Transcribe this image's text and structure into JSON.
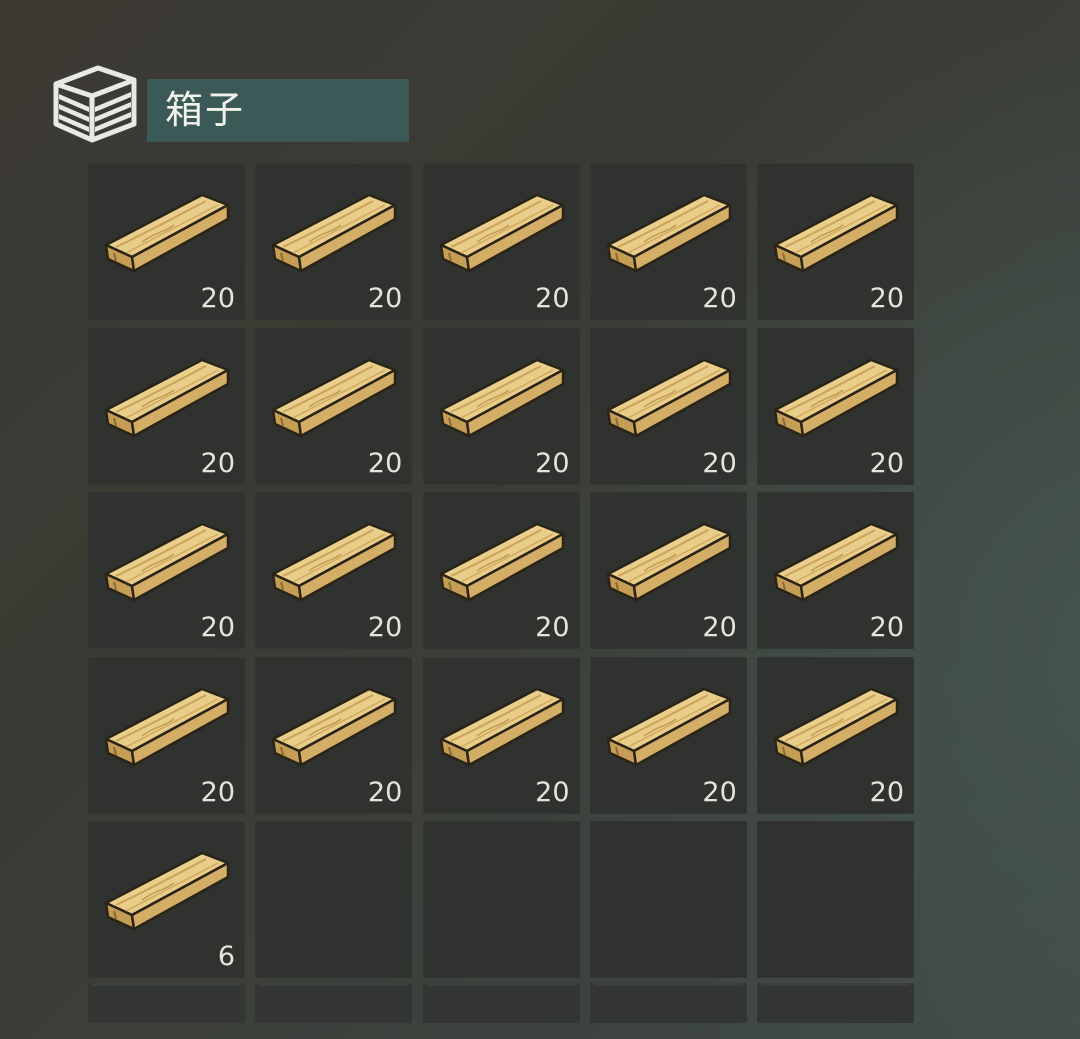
{
  "container": {
    "title": "箱子",
    "icon": "storage-box-icon"
  },
  "inventory": {
    "item_icon": "wooden-plank-icon",
    "slots": [
      {
        "item": "wooden-plank",
        "count": "20"
      },
      {
        "item": "wooden-plank",
        "count": "20"
      },
      {
        "item": "wooden-plank",
        "count": "20"
      },
      {
        "item": "wooden-plank",
        "count": "20"
      },
      {
        "item": "wooden-plank",
        "count": "20"
      },
      {
        "item": "wooden-plank",
        "count": "20"
      },
      {
        "item": "wooden-plank",
        "count": "20"
      },
      {
        "item": "wooden-plank",
        "count": "20"
      },
      {
        "item": "wooden-plank",
        "count": "20"
      },
      {
        "item": "wooden-plank",
        "count": "20"
      },
      {
        "item": "wooden-plank",
        "count": "20"
      },
      {
        "item": "wooden-plank",
        "count": "20"
      },
      {
        "item": "wooden-plank",
        "count": "20"
      },
      {
        "item": "wooden-plank",
        "count": "20"
      },
      {
        "item": "wooden-plank",
        "count": "20"
      },
      {
        "item": "wooden-plank",
        "count": "20"
      },
      {
        "item": "wooden-plank",
        "count": "20"
      },
      {
        "item": "wooden-plank",
        "count": "20"
      },
      {
        "item": "wooden-plank",
        "count": "20"
      },
      {
        "item": "wooden-plank",
        "count": "20"
      },
      {
        "item": "wooden-plank",
        "count": "6"
      },
      {
        "item": null,
        "count": null
      },
      {
        "item": null,
        "count": null
      },
      {
        "item": null,
        "count": null
      },
      {
        "item": null,
        "count": null
      }
    ]
  },
  "colors": {
    "title_bg": "#3b5a57",
    "slot_bg": "#2f322f",
    "plank_light": "#e8c981",
    "plank_dark": "#c9a35c"
  }
}
